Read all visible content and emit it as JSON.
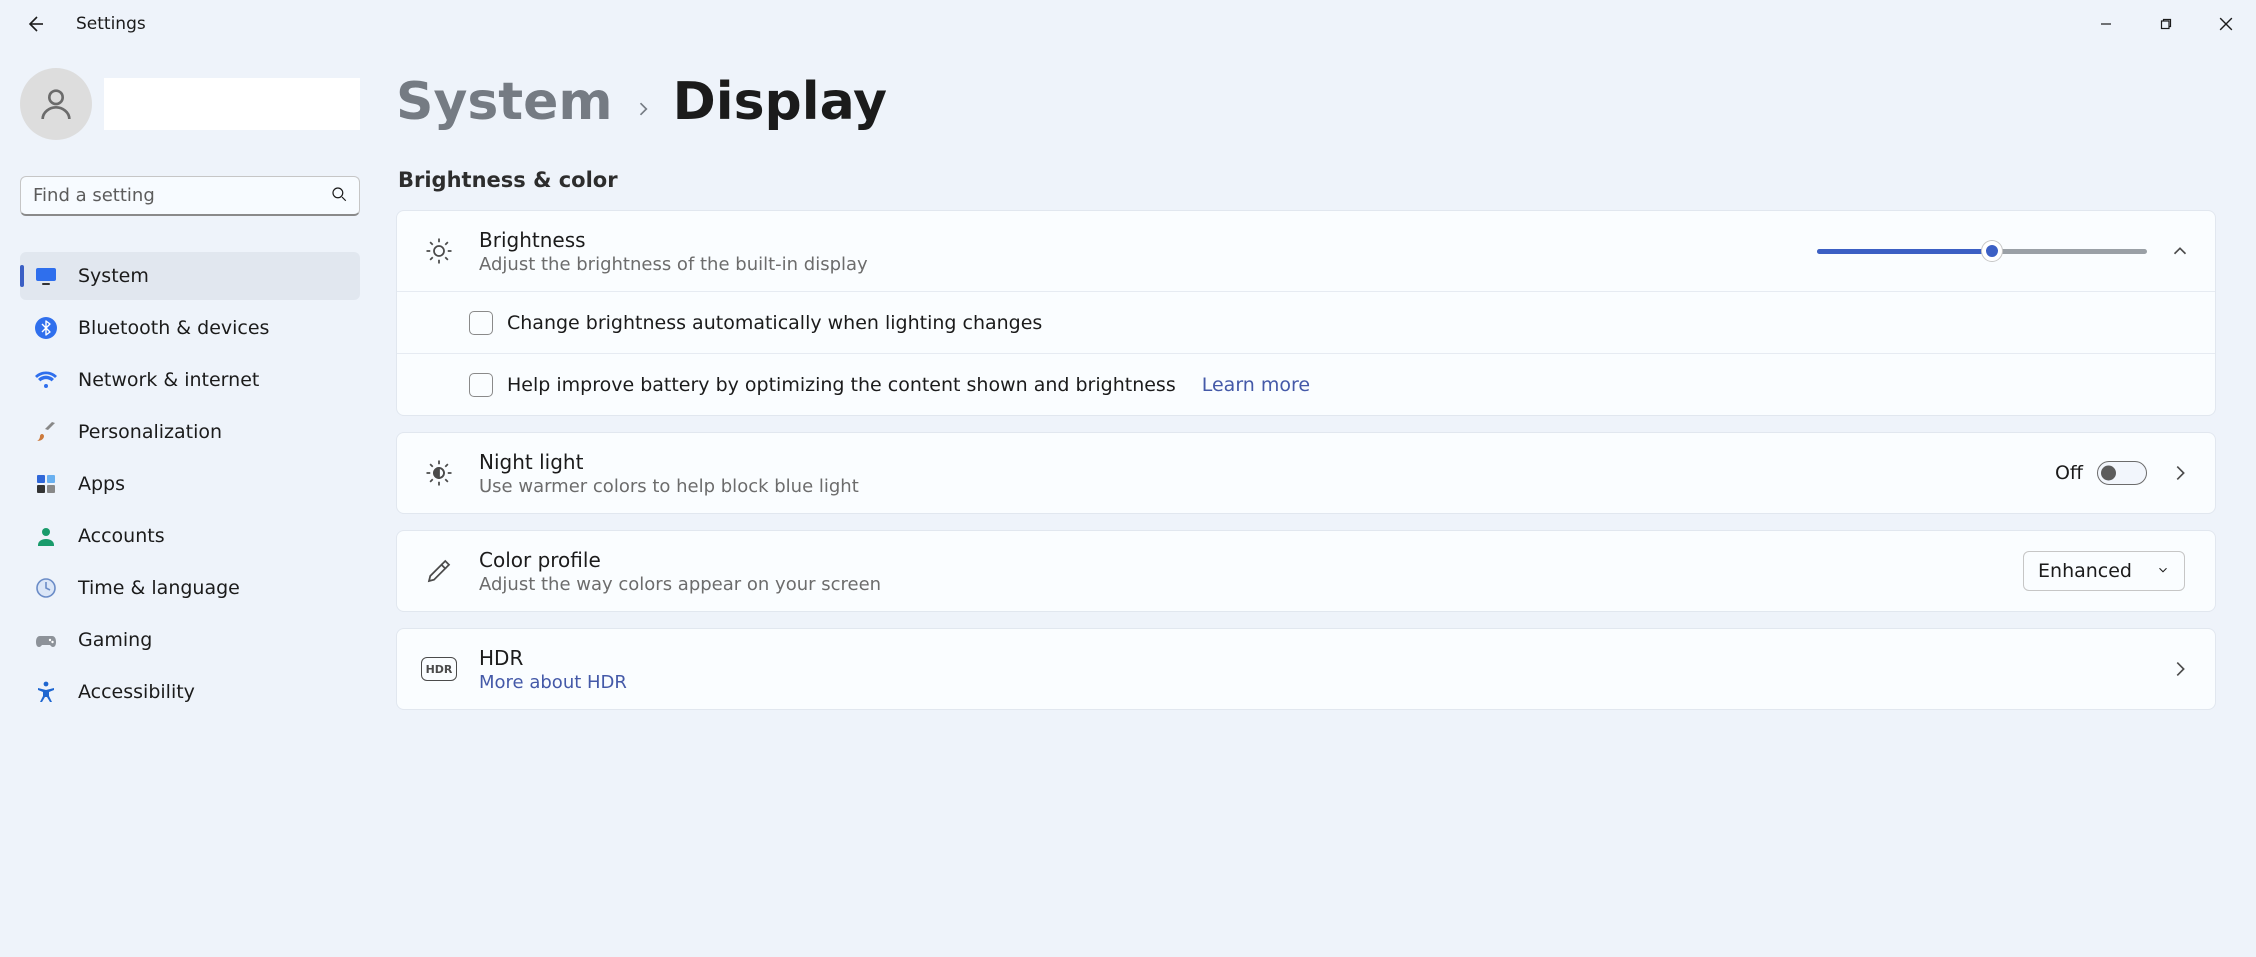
{
  "titlebar": {
    "title": "Settings"
  },
  "sidebar": {
    "search_placeholder": "Find a setting",
    "items": [
      {
        "label": "System"
      },
      {
        "label": "Bluetooth & devices"
      },
      {
        "label": "Network & internet"
      },
      {
        "label": "Personalization"
      },
      {
        "label": "Apps"
      },
      {
        "label": "Accounts"
      },
      {
        "label": "Time & language"
      },
      {
        "label": "Gaming"
      },
      {
        "label": "Accessibility"
      }
    ]
  },
  "breadcrumb": {
    "parent": "System",
    "current": "Display"
  },
  "section": {
    "brightness_color": "Brightness & color"
  },
  "brightness": {
    "title": "Brightness",
    "desc": "Adjust the brightness of the built-in display",
    "auto_label": "Change brightness automatically when lighting changes",
    "battery_label": "Help improve battery by optimizing the content shown and brightness",
    "learn_more": "Learn more"
  },
  "nightlight": {
    "title": "Night light",
    "desc": "Use warmer colors to help block blue light",
    "state": "Off"
  },
  "colorprofile": {
    "title": "Color profile",
    "desc": "Adjust the way colors appear on your screen",
    "value": "Enhanced"
  },
  "hdr": {
    "title": "HDR",
    "more": "More about HDR",
    "badge": "HDR"
  }
}
